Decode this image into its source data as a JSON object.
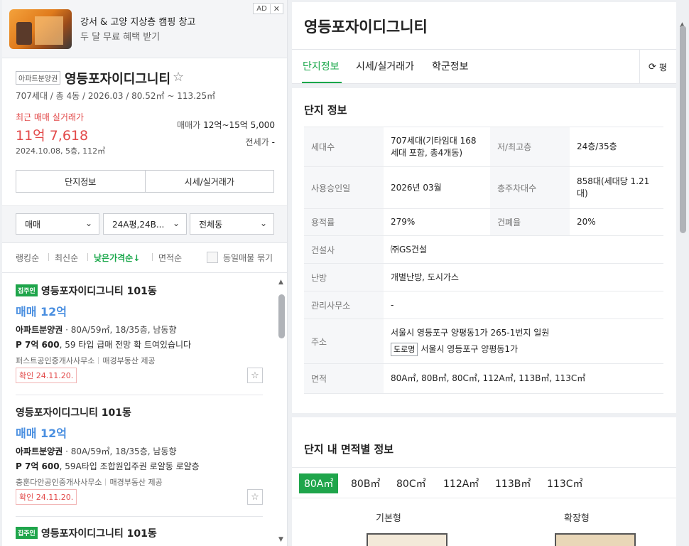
{
  "ad": {
    "title": "강서 & 고양 지상층 캠핑 창고",
    "subtitle": "두 달 무료 혜택 받기",
    "badge": "AD",
    "close": "✕"
  },
  "complex": {
    "type": "아파트분양권",
    "name": "영등포자이디그니티",
    "info": "707세대 / 총 4동 / 2026.03 / 80.52㎡ ~ 113.25㎡",
    "recent_label": "최근 매매 실거래가",
    "recent_price": "11억 7,618",
    "recent_date": "2024.10.08, 5층, 112㎡",
    "sale_label": "매매가",
    "sale_range": "12억~15억 5,000",
    "rent_label": "전세가",
    "rent_range": "-",
    "btn_info": "단지정보",
    "btn_price": "시세/실거래가"
  },
  "filters": {
    "trade": "매매",
    "area": "24A평,24B...",
    "dong": "전체동"
  },
  "sorts": {
    "ranking": "랭킹순",
    "latest": "최신순",
    "low_price": "낮은가격순↓",
    "area": "면적순",
    "group_label": "동일매물 묶기"
  },
  "listings": [
    {
      "tag": "집주인",
      "title": "영등포자이디그니티 101동",
      "price": "매매 12억",
      "spec_type": "아파트분양권",
      "spec": " · 80A/59㎡, 18/35층, 남동향",
      "desc_price": "P 7억 600",
      "desc": ", 59 타입 급매 전망 확 트여있습니다",
      "agent": "퍼스트공인중개사사무소",
      "provider": "매경부동산 제공",
      "confirm": "확인 24.11.20."
    },
    {
      "tag": "",
      "title": "영등포자이디그니티 101동",
      "price": "매매 12억",
      "spec_type": "아파트분양권",
      "spec": " · 80A/59㎡, 18/35층, 남동향",
      "desc_price": "P 7억 600",
      "desc": ", 59A타입 조합원입주권 로얄동 로얄층",
      "agent": "충훈다안공인중개사사무소",
      "provider": "매경부동산 제공",
      "confirm": "확인 24.11.20."
    },
    {
      "tag": "집주인",
      "title": "영등포자이디그니티 101동"
    }
  ],
  "detail": {
    "title": "영등포자이디그니티",
    "tabs": [
      "단지정보",
      "시세/실거래가",
      "학군정보"
    ],
    "refresh": "평",
    "section_title": "단지 정보",
    "rows": [
      {
        "k1": "세대수",
        "v1": "707세대(기타임대 168세대 포함, 총4개동)",
        "k2": "저/최고층",
        "v2": "24층/35층"
      },
      {
        "k1": "사용승인일",
        "v1": "2026년 03월",
        "k2": "총주차대수",
        "v2": "858대(세대당 1.21대)"
      },
      {
        "k1": "용적률",
        "v1": "279%",
        "k2": "건폐율",
        "v2": "20%"
      },
      {
        "k1": "건설사",
        "v1": "㈜GS건설"
      },
      {
        "k1": "난방",
        "v1": "개별난방, 도시가스"
      },
      {
        "k1": "관리사무소",
        "v1": "-"
      },
      {
        "k1": "주소",
        "v1": "서울시 영등포구 양평동1가 265-1번지 일원",
        "road_tag": "도로명",
        "v1b": "서울시 영등포구 양평동1가"
      },
      {
        "k1": "면적",
        "v1": "80A㎡, 80B㎡, 80C㎡, 112A㎡, 113B㎡, 113C㎡"
      }
    ],
    "area_title": "단지 내 면적별 정보",
    "area_tabs": [
      "80A㎡",
      "80B㎡",
      "80C㎡",
      "112A㎡",
      "113B㎡",
      "113C㎡"
    ],
    "plan_basic": "기본형",
    "plan_ext": "확장형"
  },
  "colors": {
    "accent": "#19a74a",
    "price_red": "#e24a4a",
    "price_blue": "#4a8fe0"
  }
}
